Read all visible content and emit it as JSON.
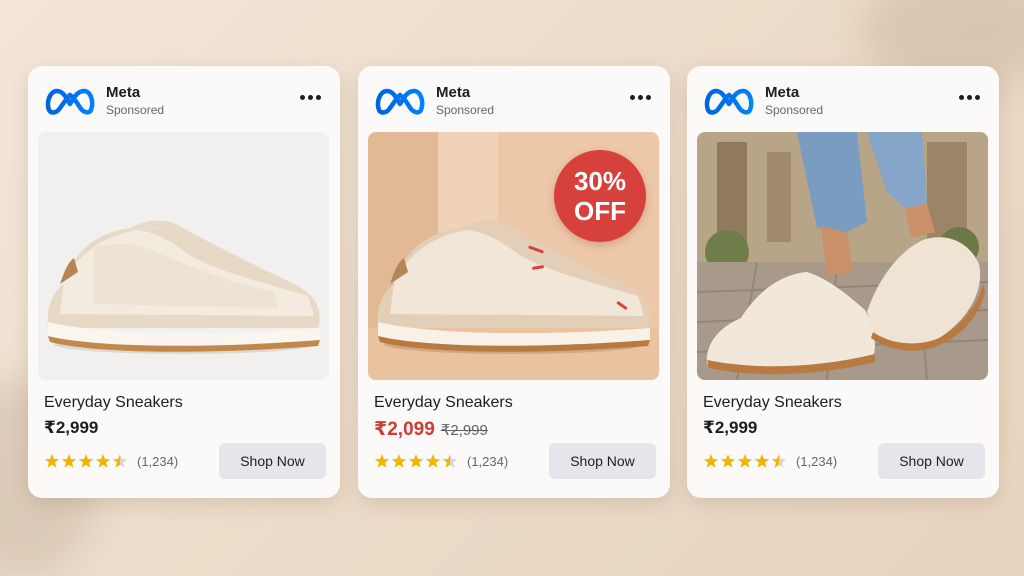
{
  "cards": [
    {
      "brand": "Meta",
      "sponsored": "Sponsored",
      "product_name": "Everyday Sneakers",
      "price": "₹2,999",
      "rating": 4.5,
      "rating_count": "(1,234)",
      "cta": "Shop Now"
    },
    {
      "brand": "Meta",
      "sponsored": "Sponsored",
      "product_name": "Everyday Sneakers",
      "price": "₹2,099",
      "original_price": "₹2,999",
      "badge_percent": "30%",
      "badge_text": "OFF",
      "rating": 4.5,
      "rating_count": "(1,234)",
      "cta": "Shop Now"
    },
    {
      "brand": "Meta",
      "sponsored": "Sponsored",
      "product_name": "Everyday Sneakers",
      "price": "₹2,999",
      "rating": 4.5,
      "rating_count": "(1,234)",
      "cta": "Shop Now"
    }
  ],
  "colors": {
    "meta_blue": "#0866ff",
    "sale_red": "#d03b36",
    "star_gold": "#f5b301",
    "button_gray": "#e4e6eb"
  },
  "icons": [
    "meta-logo-icon",
    "more-options-icon",
    "star-icon",
    "half-star-icon"
  ]
}
